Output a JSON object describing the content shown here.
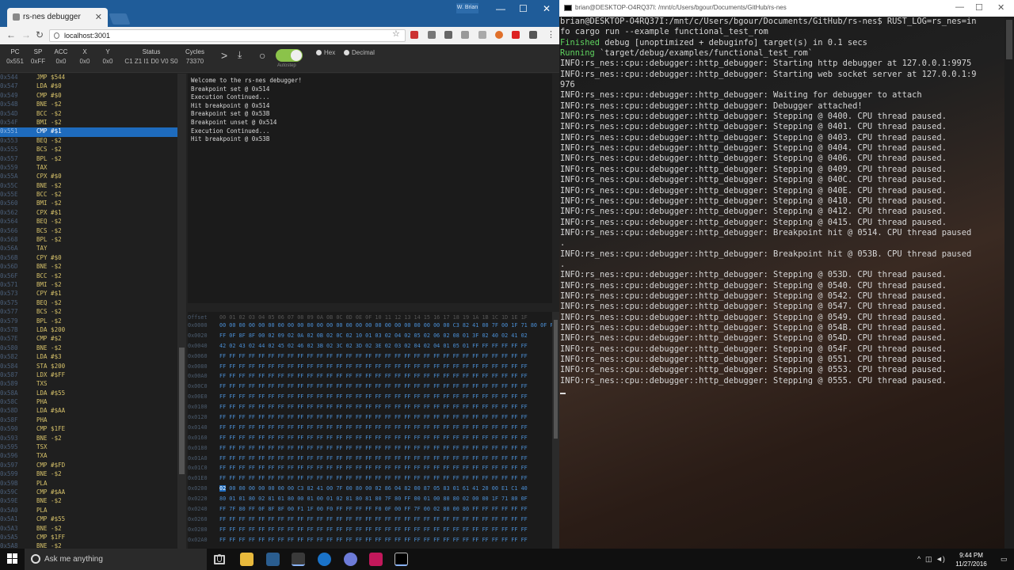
{
  "browser": {
    "tab_title": "rs-nes debugger",
    "user_label": "W. Brian",
    "url": "localhost:3001"
  },
  "registers": [
    {
      "name": "PC",
      "value": "0x551"
    },
    {
      "name": "SP",
      "value": "0xFF"
    },
    {
      "name": "ACC",
      "value": "0x0"
    },
    {
      "name": "X",
      "value": "0x0"
    },
    {
      "name": "Y",
      "value": "0x0"
    },
    {
      "name": "Status",
      "value": "C1 Z1 I1 D0 V0 S0"
    },
    {
      "name": "Cycles",
      "value": "73370"
    }
  ],
  "controls": {
    "autostep_label": "Autostep",
    "hex_label": "Hex",
    "decimal_label": "Decimal"
  },
  "code": [
    [
      "0x544",
      "JMP $544"
    ],
    [
      "0x547",
      "LDA #$0"
    ],
    [
      "0x549",
      "CMP #$0"
    ],
    [
      "0x54B",
      "BNE -$2"
    ],
    [
      "0x54D",
      "BCC -$2"
    ],
    [
      "0x54F",
      "BMI -$2"
    ],
    [
      "0x551",
      "CMP #$1"
    ],
    [
      "0x553",
      "BEQ -$2"
    ],
    [
      "0x555",
      "BCS -$2"
    ],
    [
      "0x557",
      "BPL -$2"
    ],
    [
      "0x559",
      "TAX"
    ],
    [
      "0x55A",
      "CPX #$0"
    ],
    [
      "0x55C",
      "BNE -$2"
    ],
    [
      "0x55E",
      "BCC -$2"
    ],
    [
      "0x560",
      "BMI -$2"
    ],
    [
      "0x562",
      "CPX #$1"
    ],
    [
      "0x564",
      "BEQ -$2"
    ],
    [
      "0x566",
      "BCS -$2"
    ],
    [
      "0x568",
      "BPL -$2"
    ],
    [
      "0x56A",
      "TAY"
    ],
    [
      "0x56B",
      "CPY #$0"
    ],
    [
      "0x56D",
      "BNE -$2"
    ],
    [
      "0x56F",
      "BCC -$2"
    ],
    [
      "0x571",
      "BMI -$2"
    ],
    [
      "0x573",
      "CPY #$1"
    ],
    [
      "0x575",
      "BEQ -$2"
    ],
    [
      "0x577",
      "BCS -$2"
    ],
    [
      "0x579",
      "BPL -$2"
    ],
    [
      "0x57B",
      "LDA $200"
    ],
    [
      "0x57E",
      "CMP #$2"
    ],
    [
      "0x580",
      "BNE -$2"
    ],
    [
      "0x582",
      "LDA #$3"
    ],
    [
      "0x584",
      "STA $200"
    ],
    [
      "0x587",
      "LDX #$FF"
    ],
    [
      "0x589",
      "TXS"
    ],
    [
      "0x58A",
      "LDA #$55"
    ],
    [
      "0x58C",
      "PHA"
    ],
    [
      "0x58D",
      "LDA #$AA"
    ],
    [
      "0x58F",
      "PHA"
    ],
    [
      "0x590",
      "CMP $1FE"
    ],
    [
      "0x593",
      "BNE -$2"
    ],
    [
      "0x595",
      "TSX"
    ],
    [
      "0x596",
      "TXA"
    ],
    [
      "0x597",
      "CMP #$FD"
    ],
    [
      "0x599",
      "BNE -$2"
    ],
    [
      "0x59B",
      "PLA"
    ],
    [
      "0x59C",
      "CMP #$AA"
    ],
    [
      "0x59E",
      "BNE -$2"
    ],
    [
      "0x5A0",
      "PLA"
    ],
    [
      "0x5A1",
      "CMP #$55"
    ],
    [
      "0x5A3",
      "BNE -$2"
    ],
    [
      "0x5A5",
      "CMP $1FF"
    ],
    [
      "0x5A8",
      "BNE -$2"
    ]
  ],
  "selected_code_index": 6,
  "log": [
    "Welcome to the rs-nes debugger!",
    "Breakpoint set @ 0x514",
    "Execution Continued...",
    "Hit breakpoint @ 0x514",
    "Breakpoint set @ 0x53B",
    "Breakpoint unset @ 0x514",
    "Execution Continued...",
    "Hit breakpoint @ 0x53B"
  ],
  "memory": {
    "header_label": "Offset",
    "columns": "00 01 02 03 04 05 06 07 08 09 0A 0B 0C 0D 0E 0F 10 11 12 13 14 15 16 17 18 19 1A 1B 1C 1D 1E 1F",
    "rows": [
      [
        "0x0000",
        "00 00 00 00 00 00 00 00 00 00 00 00 00 00 00 00 00 00 00 00 00 00 00 00 C3 82 41 00 7F 00 1F 71 80 0F FF 7F 80"
      ],
      [
        "0x0020",
        "FF 0F 8F 8F 00 02 09 02 0A 02 0B 02 0C 02 10 01 03 02 04 02 05 02 06 02 08 01 3F 02 40 02 41 02"
      ],
      [
        "0x0040",
        "42 02 43 02 44 02 45 02 46 02 3B 02 3C 02 3D 02 3E 02 03 02 04 02 04 01 05 01 FF FF FF FF FF FF"
      ],
      [
        "0x0060",
        "FF FF FF FF FF FF FF FF FF FF FF FF FF FF FF FF FF FF FF FF FF FF FF FF FF FF FF FF FF FF FF FF"
      ],
      [
        "0x0080",
        "FF FF FF FF FF FF FF FF FF FF FF FF FF FF FF FF FF FF FF FF FF FF FF FF FF FF FF FF FF FF FF FF"
      ],
      [
        "0x00A0",
        "FF FF FF FF FF FF FF FF FF FF FF FF FF FF FF FF FF FF FF FF FF FF FF FF FF FF FF FF FF FF FF FF"
      ],
      [
        "0x00C0",
        "FF FF FF FF FF FF FF FF FF FF FF FF FF FF FF FF FF FF FF FF FF FF FF FF FF FF FF FF FF FF FF FF"
      ],
      [
        "0x00E0",
        "FF FF FF FF FF FF FF FF FF FF FF FF FF FF FF FF FF FF FF FF FF FF FF FF FF FF FF FF FF FF FF FF"
      ],
      [
        "0x0100",
        "FF FF FF FF FF FF FF FF FF FF FF FF FF FF FF FF FF FF FF FF FF FF FF FF FF FF FF FF FF FF FF FF"
      ],
      [
        "0x0120",
        "FF FF FF FF FF FF FF FF FF FF FF FF FF FF FF FF FF FF FF FF FF FF FF FF FF FF FF FF FF FF FF FF"
      ],
      [
        "0x0140",
        "FF FF FF FF FF FF FF FF FF FF FF FF FF FF FF FF FF FF FF FF FF FF FF FF FF FF FF FF FF FF FF FF"
      ],
      [
        "0x0160",
        "FF FF FF FF FF FF FF FF FF FF FF FF FF FF FF FF FF FF FF FF FF FF FF FF FF FF FF FF FF FF FF FF"
      ],
      [
        "0x0180",
        "FF FF FF FF FF FF FF FF FF FF FF FF FF FF FF FF FF FF FF FF FF FF FF FF FF FF FF FF FF FF FF FF"
      ],
      [
        "0x01A0",
        "FF FF FF FF FF FF FF FF FF FF FF FF FF FF FF FF FF FF FF FF FF FF FF FF FF FF FF FF FF FF FF FF"
      ],
      [
        "0x01C0",
        "FF FF FF FF FF FF FF FF FF FF FF FF FF FF FF FF FF FF FF FF FF FF FF FF FF FF FF FF FF FF FF FF"
      ],
      [
        "0x01E0",
        "FF FF FF FF FF FF FF FF FF FF FF FF FF FF FF FF FF FF FF FF FF FF FF FF FF FF FF FF FF FF FF FF"
      ],
      [
        "0x0200",
        "02 00 00 00 00 00 00 00 C3 82 41 00 7F 00 80 00 02 86 04 82 00 87 05 83 01 61 41 20 00 E1 C1 40"
      ],
      [
        "0x0220",
        "80 01 01 80 02 81 01 80 00 01 00 01 02 81 80 81 80 7F 80 FF 00 01 00 80 80 02 00 00 1F 71 80 0F"
      ],
      [
        "0x0240",
        "FF 7F 80 FF 0F 8F 8F 00 F1 1F 00 F0 FF FF FF FF F0 0F 00 FF 7F 00 02 80 00 80 FF FF FF FF FF FF"
      ],
      [
        "0x0260",
        "FF FF FF FF FF FF FF FF FF FF FF FF FF FF FF FF FF FF FF FF FF FF FF FF FF FF FF FF FF FF FF FF"
      ],
      [
        "0x0280",
        "FF FF FF FF FF FF FF FF FF FF FF FF FF FF FF FF FF FF FF FF FF FF FF FF FF FF FF FF FF FF FF FF"
      ],
      [
        "0x02A0",
        "FF FF FF FF FF FF FF FF FF FF FF FF FF FF FF FF FF FF FF FF FF FF FF FF FF FF FF FF FF FF FF FF"
      ]
    ],
    "highlight_row": 16
  },
  "terminal": {
    "title": "brian@DESKTOP-O4RQ37I: /mnt/c/Users/bgour/Documents/GitHub/rs-nes",
    "lines": [
      {
        "t": "brian@DESKTOP-O4RQ37I:/mnt/c/Users/bgour/Documents/GitHub/rs-nes$ RUST_LOG=rs_nes=in"
      },
      {
        "t": "fo cargo run --example functional_test_rom"
      },
      {
        "g": "    Finished",
        "t": " debug [unoptimized + debuginfo] target(s) in 0.1 secs"
      },
      {
        "g": "     Running",
        "t": " `target/debug/examples/functional_test_rom`"
      },
      {
        "t": "INFO:rs_nes::cpu::debugger::http_debugger: Starting http debugger at 127.0.0.1:9975"
      },
      {
        "t": "INFO:rs_nes::cpu::debugger::http_debugger: Starting web socket server at 127.0.0.1:9"
      },
      {
        "t": "976"
      },
      {
        "t": "INFO:rs_nes::cpu::debugger::http_debugger: Waiting for debugger to attach"
      },
      {
        "t": "INFO:rs_nes::cpu::debugger::http_debugger: Debugger attached!"
      },
      {
        "t": "INFO:rs_nes::cpu::debugger::http_debugger: Stepping @ 0400.  CPU thread paused."
      },
      {
        "t": "INFO:rs_nes::cpu::debugger::http_debugger: Stepping @ 0401.  CPU thread paused."
      },
      {
        "t": "INFO:rs_nes::cpu::debugger::http_debugger: Stepping @ 0403.  CPU thread paused."
      },
      {
        "t": "INFO:rs_nes::cpu::debugger::http_debugger: Stepping @ 0404.  CPU thread paused."
      },
      {
        "t": "INFO:rs_nes::cpu::debugger::http_debugger: Stepping @ 0406.  CPU thread paused."
      },
      {
        "t": "INFO:rs_nes::cpu::debugger::http_debugger: Stepping @ 0409.  CPU thread paused."
      },
      {
        "t": "INFO:rs_nes::cpu::debugger::http_debugger: Stepping @ 040C.  CPU thread paused."
      },
      {
        "t": "INFO:rs_nes::cpu::debugger::http_debugger: Stepping @ 040E.  CPU thread paused."
      },
      {
        "t": "INFO:rs_nes::cpu::debugger::http_debugger: Stepping @ 0410.  CPU thread paused."
      },
      {
        "t": "INFO:rs_nes::cpu::debugger::http_debugger: Stepping @ 0412.  CPU thread paused."
      },
      {
        "t": "INFO:rs_nes::cpu::debugger::http_debugger: Stepping @ 0415.  CPU thread paused."
      },
      {
        "t": "INFO:rs_nes::cpu::debugger::http_debugger: Breakpoint hit @ 0514.  CPU thread paused"
      },
      {
        "t": "."
      },
      {
        "t": "INFO:rs_nes::cpu::debugger::http_debugger: Breakpoint hit @ 053B.  CPU thread paused"
      },
      {
        "t": "."
      },
      {
        "t": "INFO:rs_nes::cpu::debugger::http_debugger: Stepping @ 053D.  CPU thread paused."
      },
      {
        "t": "INFO:rs_nes::cpu::debugger::http_debugger: Stepping @ 0540.  CPU thread paused."
      },
      {
        "t": "INFO:rs_nes::cpu::debugger::http_debugger: Stepping @ 0542.  CPU thread paused."
      },
      {
        "t": "INFO:rs_nes::cpu::debugger::http_debugger: Stepping @ 0547.  CPU thread paused."
      },
      {
        "t": "INFO:rs_nes::cpu::debugger::http_debugger: Stepping @ 0549.  CPU thread paused."
      },
      {
        "t": "INFO:rs_nes::cpu::debugger::http_debugger: Stepping @ 054B.  CPU thread paused."
      },
      {
        "t": "INFO:rs_nes::cpu::debugger::http_debugger: Stepping @ 054D.  CPU thread paused."
      },
      {
        "t": "INFO:rs_nes::cpu::debugger::http_debugger: Stepping @ 054F.  CPU thread paused."
      },
      {
        "t": "INFO:rs_nes::cpu::debugger::http_debugger: Stepping @ 0551.  CPU thread paused."
      },
      {
        "t": "INFO:rs_nes::cpu::debugger::http_debugger: Stepping @ 0553.  CPU thread paused."
      },
      {
        "t": "INFO:rs_nes::cpu::debugger::http_debugger: Stepping @ 0555.  CPU thread paused."
      }
    ]
  },
  "taskbar": {
    "search_placeholder": "Ask me anything",
    "time": "9:44 PM",
    "date": "11/27/2016"
  }
}
